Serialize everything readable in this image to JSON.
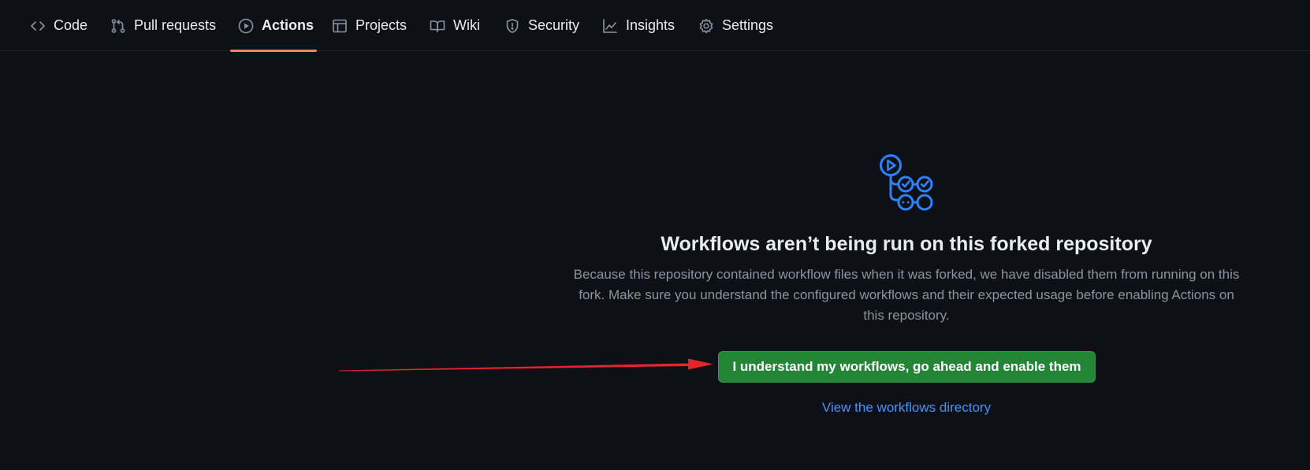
{
  "nav": {
    "tabs": [
      {
        "label": "Code",
        "icon": "code-icon",
        "active": false
      },
      {
        "label": "Pull requests",
        "icon": "git-pull-request-icon",
        "active": false
      },
      {
        "label": "Actions",
        "icon": "play-icon",
        "active": true
      },
      {
        "label": "Projects",
        "icon": "table-icon",
        "active": false
      },
      {
        "label": "Wiki",
        "icon": "book-icon",
        "active": false
      },
      {
        "label": "Security",
        "icon": "shield-icon",
        "active": false
      },
      {
        "label": "Insights",
        "icon": "graph-icon",
        "active": false
      },
      {
        "label": "Settings",
        "icon": "gear-icon",
        "active": false
      }
    ],
    "active_color": "#f78166"
  },
  "blankslate": {
    "icon": "workflow-icon",
    "heading": "Workflows aren’t being run on this forked repository",
    "description": "Because this repository contained workflow files when it was forked, we have disabled them from running on this fork. Make sure you understand the configured workflows and their expected usage before enabling Actions on this repository.",
    "enable_button_label": "I understand my workflows, go ahead and enable them",
    "link_label": "View the workflows directory"
  },
  "annotation": {
    "icon": "red-arrow",
    "color": "#e5252a"
  },
  "colors": {
    "background": "#0d1117",
    "button": "#238636",
    "link": "#4493f8",
    "icon_accent": "#2f81f7"
  }
}
